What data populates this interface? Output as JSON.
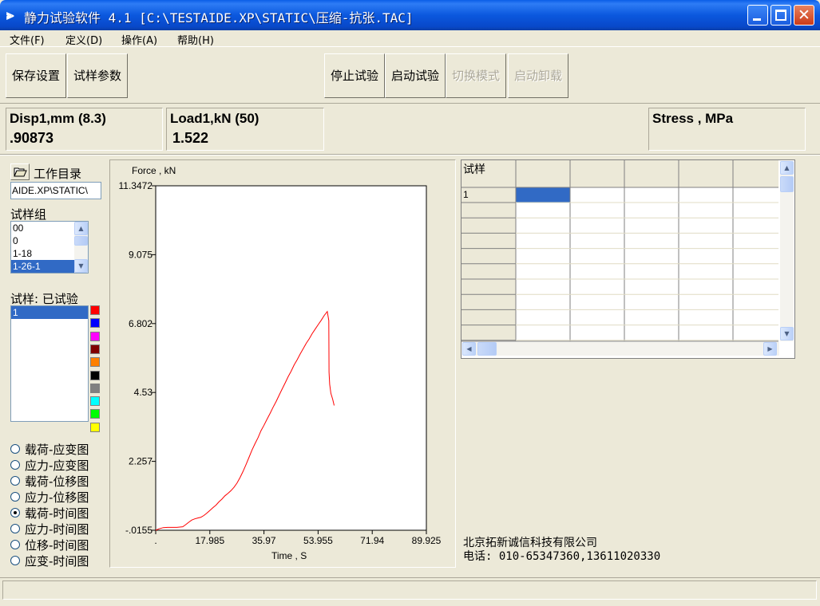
{
  "window": {
    "title": "静力试验软件 4.1 [C:\\TESTAIDE.XP\\STATIC\\压缩-抗张.TAC]"
  },
  "menu": [
    {
      "label": "文件(F)"
    },
    {
      "label": "定义(D)"
    },
    {
      "label": "操作(A)"
    },
    {
      "label": "帮助(H)"
    }
  ],
  "toolbar": {
    "save_settings": "保存设置",
    "sample_params": "试样参数",
    "stop_test": "停止试验",
    "start_test": "启动试验",
    "switch_mode": "切换模式",
    "start_unload": "启动卸载"
  },
  "readouts": {
    "disp": {
      "label": "Disp1,mm (8.3)",
      "value": ".90873"
    },
    "load": {
      "label": "Load1,kN (50)",
      "value": "1.522"
    },
    "stress": {
      "label": "Stress , MPa",
      "value": ""
    }
  },
  "left": {
    "workdir_label": "工作目录",
    "workdir_path": "AIDE.XP\\STATIC\\",
    "group_label": "试样组",
    "groups": [
      "00",
      "0",
      "1-18",
      "1-26-1"
    ],
    "selected_group": 3,
    "sample_label": "试样: 已试验",
    "samples": [
      "1"
    ],
    "swatch_colors": [
      "#ff0000",
      "#0000ff",
      "#ff00ff",
      "#800000",
      "#ff8000",
      "#000000",
      "#808080",
      "#00ffff",
      "#00ff00",
      "#ffff00"
    ],
    "plot_options": [
      {
        "label": "载荷-应变图",
        "checked": false
      },
      {
        "label": "应力-应变图",
        "checked": false
      },
      {
        "label": "载荷-位移图",
        "checked": false
      },
      {
        "label": "应力-位移图",
        "checked": false
      },
      {
        "label": "载荷-时间图",
        "checked": true
      },
      {
        "label": "应力-时间图",
        "checked": false
      },
      {
        "label": "位移-时间图",
        "checked": false
      },
      {
        "label": "应变-时间图",
        "checked": false
      }
    ]
  },
  "chart_data": {
    "type": "line",
    "ylabel": "Force , kN",
    "xlabel": "Time , S",
    "xlim": [
      0,
      89.925
    ],
    "ylim": [
      -0.0155,
      11.3472
    ],
    "x_ticks": [
      ".",
      "17.985",
      "35.97",
      "53.955",
      "71.94",
      "89.925"
    ],
    "x_tick_values": [
      0,
      17.985,
      35.97,
      53.955,
      71.94,
      89.925
    ],
    "y_ticks": [
      "11.3472",
      "9.075",
      "6.802",
      "4.53",
      "2.257",
      "-.0155"
    ],
    "y_tick_values": [
      11.3472,
      9.075,
      6.802,
      4.53,
      2.257,
      -0.0155
    ],
    "line_color": "#ff0000",
    "series": [
      {
        "x": [
          0,
          1,
          2.5,
          4,
          5.5,
          7,
          8,
          9,
          10,
          11,
          12,
          13,
          14,
          15,
          16,
          17,
          18,
          19,
          20,
          21,
          22,
          23,
          24,
          25,
          26,
          27,
          28,
          29,
          30,
          31,
          32,
          33,
          34,
          35,
          36,
          37,
          38,
          39,
          40,
          41,
          42,
          43,
          44,
          45,
          46,
          47,
          48,
          49,
          50,
          51,
          52,
          53,
          54,
          55,
          56,
          57,
          57.5,
          57.6,
          57.8,
          58.2,
          58.8,
          59.3
        ],
        "y": [
          -0.0155,
          0.03,
          0.07,
          0.08,
          0.08,
          0.08,
          0.09,
          0.1,
          0.17,
          0.25,
          0.32,
          0.36,
          0.39,
          0.41,
          0.47,
          0.55,
          0.64,
          0.73,
          0.81,
          0.92,
          1.01,
          1.12,
          1.2,
          1.29,
          1.4,
          1.54,
          1.72,
          1.92,
          2.15,
          2.39,
          2.63,
          2.84,
          3.04,
          3.27,
          3.45,
          3.65,
          3.84,
          4.04,
          4.23,
          4.44,
          4.64,
          4.84,
          5.05,
          5.23,
          5.44,
          5.61,
          5.8,
          5.97,
          6.15,
          6.3,
          6.47,
          6.62,
          6.77,
          6.91,
          7.07,
          7.2,
          6.9,
          5.2,
          4.8,
          4.5,
          4.3,
          4.1
        ]
      }
    ]
  },
  "grid": {
    "header": "试样",
    "first_row": "1"
  },
  "company": {
    "name": "北京拓新诚信科技有限公司",
    "phone": "电话: 010-65347360,13611020330"
  }
}
